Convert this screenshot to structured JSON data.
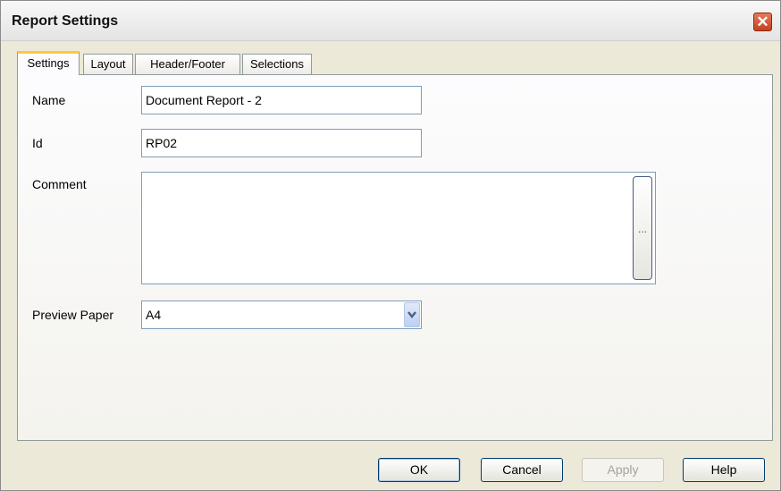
{
  "window": {
    "title": "Report Settings",
    "close_symbol": "✕"
  },
  "tabs": [
    {
      "label": "Settings",
      "active": true
    },
    {
      "label": "Layout",
      "active": false
    },
    {
      "label": "Header/Footer",
      "active": false
    },
    {
      "label": "Selections",
      "active": false
    }
  ],
  "form": {
    "name": {
      "label": "Name",
      "value": "Document Report - 2"
    },
    "id": {
      "label": "Id",
      "value": "RP02"
    },
    "comment": {
      "label": "Comment",
      "value": "",
      "browse_label": "..."
    },
    "preview_paper": {
      "label": "Preview Paper",
      "value": "A4"
    }
  },
  "buttons": {
    "ok": "OK",
    "cancel": "Cancel",
    "apply": "Apply",
    "help": "Help"
  },
  "colors": {
    "active_tab_accent": "#ffc83c",
    "close_button": "#c4401f",
    "field_border": "#7f9db9"
  }
}
